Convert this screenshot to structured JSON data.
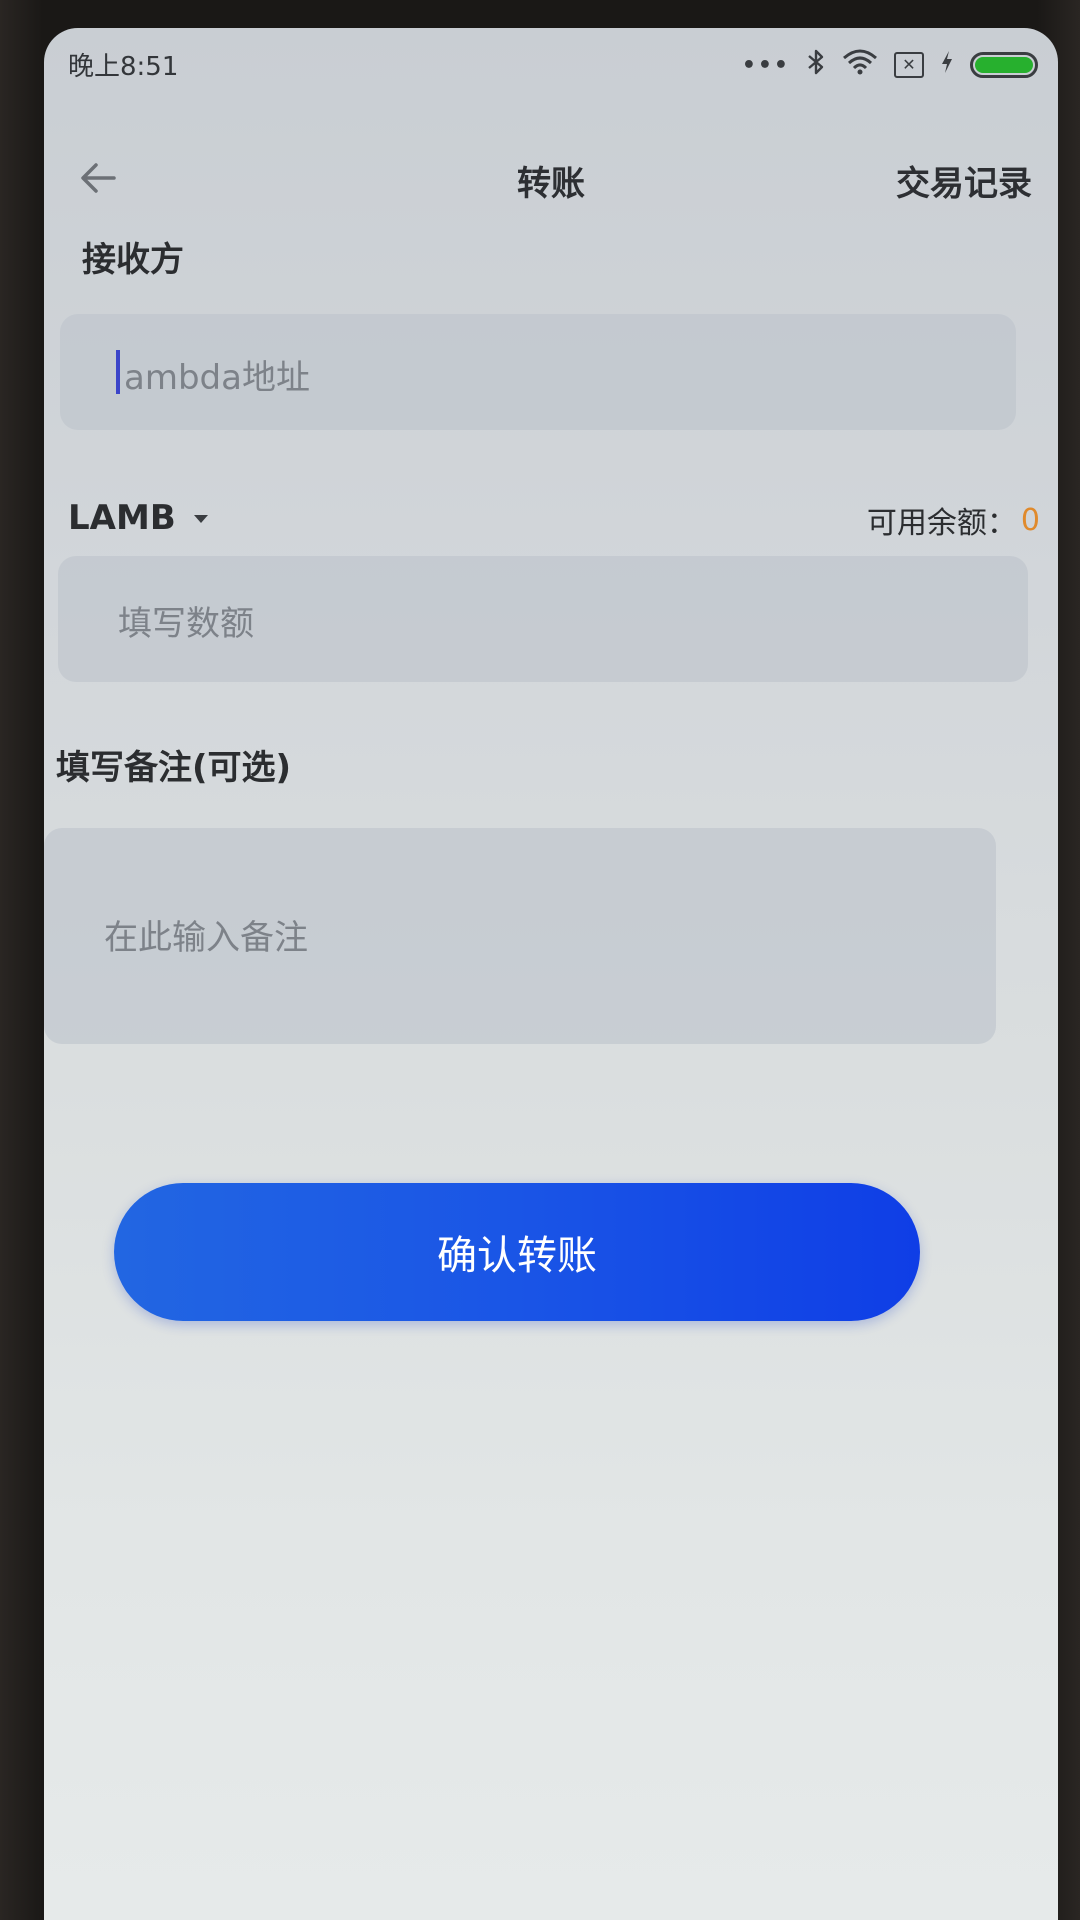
{
  "status_bar": {
    "time": "晚上8:51",
    "icons": [
      "signal-dots-icon",
      "bluetooth-icon",
      "wifi-icon",
      "sim-icon",
      "charging-icon",
      "battery-icon"
    ],
    "battery_color": "#27b02e"
  },
  "header": {
    "title": "转账",
    "records_label": "交易记录"
  },
  "receiver": {
    "label": "接收方",
    "placeholder": "ambda地址"
  },
  "token": {
    "name": "LAMB",
    "balance_label": "可用余额：",
    "balance_value": "0"
  },
  "amount": {
    "placeholder": "填写数额"
  },
  "memo": {
    "label": "填写备注(可选)",
    "placeholder": "在此输入备注"
  },
  "confirm": {
    "label": "确认转账"
  },
  "colors": {
    "accent": "#1a55e6",
    "balance": "#e08a2c"
  }
}
